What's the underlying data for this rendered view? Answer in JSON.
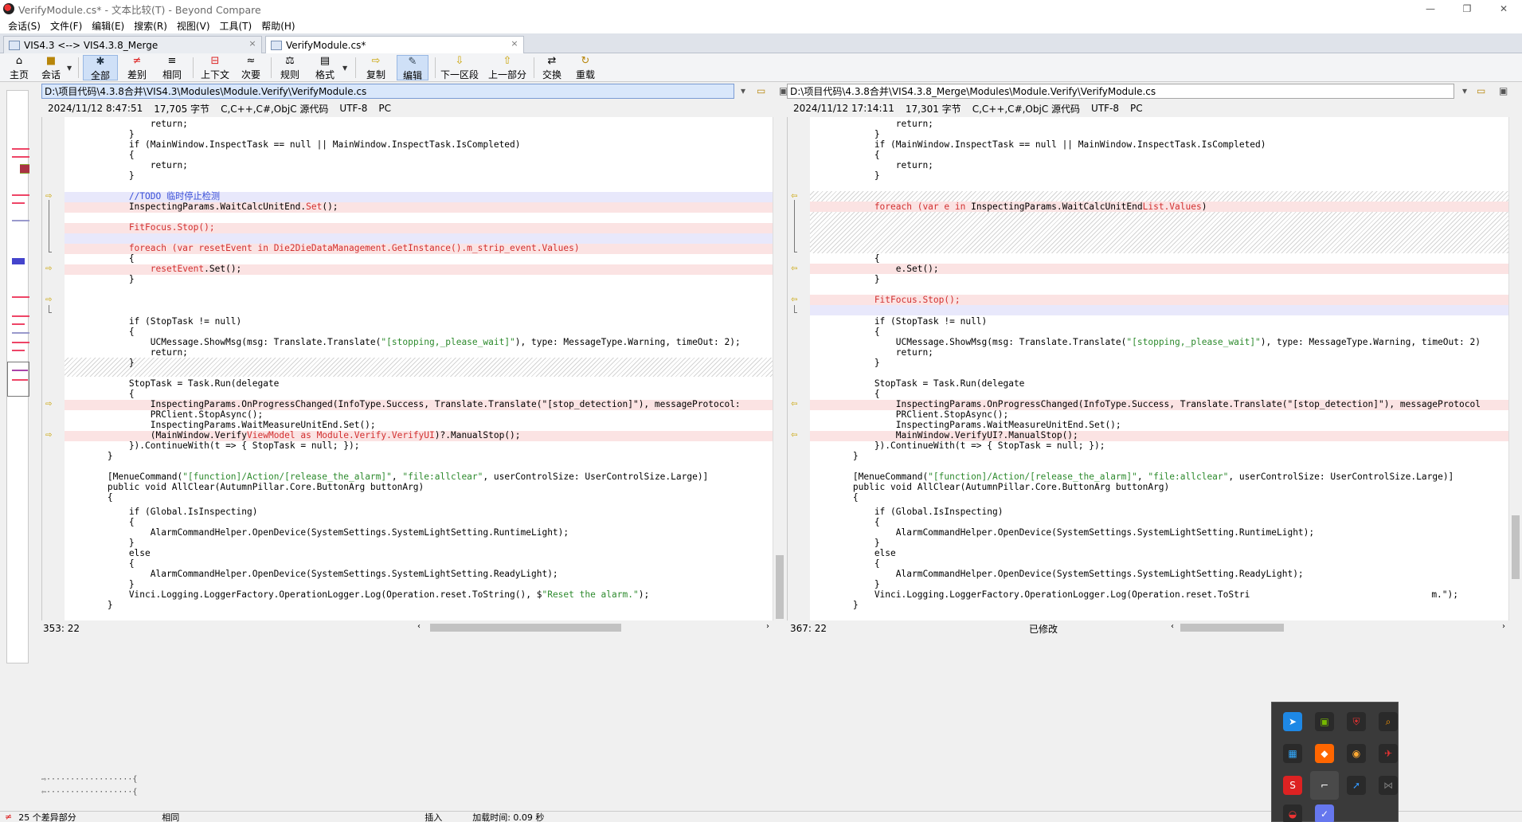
{
  "window": {
    "title": "VerifyModule.cs* - 文本比较(T) - Beyond Compare",
    "minimize": "—",
    "restore": "❐",
    "close": "✕"
  },
  "menu": [
    "会话(S)",
    "文件(F)",
    "编辑(E)",
    "搜索(R)",
    "视图(V)",
    "工具(T)",
    "帮助(H)"
  ],
  "tabs": [
    {
      "label": "VIS4.3 <--> VIS4.3.8_Merge",
      "close": "×"
    },
    {
      "label": "VerifyModule.cs*",
      "close": "×"
    }
  ],
  "toolbar": {
    "home": "主页",
    "session": "会话",
    "all": "全部",
    "diffs": "差别",
    "same": "相同",
    "context": "上下文",
    "minor": "次要",
    "rules": "规则",
    "format": "格式",
    "copy": "复制",
    "edit": "编辑",
    "next_section": "下一区段",
    "prev_section": "上一部分",
    "swap": "交换",
    "reload": "重载"
  },
  "left": {
    "path": "D:\\项目代码\\4.3.8合并\\VIS4.3\\Modules\\Module.Verify\\VerifyModule.cs",
    "timestamp": "2024/11/12 8:47:51",
    "size": "17,705 字节",
    "syntax": "C,C++,C#,ObjC 源代码",
    "encoding": "UTF-8",
    "lineend": "PC",
    "cursor": "353: 22",
    "modified": ""
  },
  "right": {
    "path": "D:\\项目代码\\4.3.8合并\\VIS4.3.8_Merge\\Modules\\Module.Verify\\VerifyModule.cs",
    "timestamp": "2024/11/12 17:14:11",
    "size": "17,301 字节",
    "syntax": "C,C++,C#,ObjC 源代码",
    "encoding": "UTF-8",
    "lineend": "PC",
    "cursor": "367: 22",
    "modified": "已修改"
  },
  "code_left": {
    "l1": "                return;",
    "l2": "            }",
    "l3": "            if (MainWindow.InspectTask == null || MainWindow.InspectTask.IsCompleted)",
    "l4": "            {",
    "l5": "                return;",
    "l6": "            }",
    "l7a": "            ",
    "l7b": "//TODO 临时停止检测",
    "l8a": "            InspectingParams.WaitCalcUnitEnd.",
    "l8b": "Set",
    "l8c": "();",
    "l9": "            FitFocus.Stop();",
    "l10a": "            foreach (var resetEvent in ",
    "l10b": "Die2DieDataManagement.GetInstance().m_strip_event.Values",
    "l10c": ")",
    "l11": "            {",
    "l12a": "                ",
    "l12b": "resetEvent",
    "l12c": ".Set();",
    "l13": "            }",
    "l14": "            if (StopTask != null)",
    "l15": "            {",
    "l16a": "                UCMessage.ShowMsg(msg: Translate.Translate(",
    "l16b": "\"[stopping,_please_wait]\"",
    "l16c": "), type: MessageType.Warning, timeOut: 2);",
    "l17": "                return;",
    "l18": "            }",
    "l19": "            StopTask = Task.Run(delegate",
    "l20": "            {",
    "l21": "                InspectingParams.OnProgressChanged(InfoType.Success, Translate.Translate(\"[stop_detection]\"), messageProtocol:",
    "l22": "                PRClient.StopAsync();",
    "l23": "                InspectingParams.WaitMeasureUnitEnd.Set();",
    "l24a": "                (MainWindow.Verify",
    "l24b": "ViewModel as Module.Verify.VerifyUI",
    "l24c": ")?.ManualStop();",
    "l25": "            }).ContinueWith(t => { StopTask = null; });",
    "l26": "        }",
    "l27a": "        [MenueCommand(",
    "l27b": "\"[function]/Action/[release_the_alarm]\"",
    "l27c": ", ",
    "l27d": "\"file:allclear\"",
    "l27e": ", userControlSize: UserControlSize.Large)]",
    "l28": "        public void AllClear(AutumnPillar.Core.ButtonArg buttonArg)",
    "l29": "        {",
    "l30": "            if (Global.IsInspecting)",
    "l31": "            {",
    "l32": "                AlarmCommandHelper.OpenDevice(SystemSettings.SystemLightSetting.RuntimeLight);",
    "l33": "            }",
    "l34": "            else",
    "l35": "            {",
    "l36": "                AlarmCommandHelper.OpenDevice(SystemSettings.SystemLightSetting.ReadyLight);",
    "l37": "            }",
    "l38a": "            Vinci.Logging.LoggerFactory.OperationLogger.Log(Operation.reset.ToString(), $",
    "l38b": "\"Reset the alarm.\"",
    "l38c": ");",
    "l39": "        }"
  },
  "code_right": {
    "r1": "                return;",
    "r2": "            }",
    "r3": "            if (MainWindow.InspectTask == null || MainWindow.InspectTask.IsCompleted)",
    "r4": "            {",
    "r5": "                return;",
    "r6": "            }",
    "r8a": "            foreach (var e in ",
    "r8b": "InspectingParams.WaitCalcUnitEnd",
    "r8c": "List.Values",
    "r8d": ")",
    "r11": "            {",
    "r12": "                e.Set();",
    "r13": "            }",
    "r13b": "            FitFocus.Stop();",
    "r14": "            if (StopTask != null)",
    "r15": "            {",
    "r16a": "                UCMessage.ShowMsg(msg: Translate.Translate(",
    "r16b": "\"[stopping,_please_wait]\"",
    "r16c": "), type: MessageType.Warning, timeOut: 2)",
    "r17": "                return;",
    "r18": "            }",
    "r19": "            StopTask = Task.Run(delegate",
    "r20": "            {",
    "r21": "                InspectingParams.OnProgressChanged(InfoType.Success, Translate.Translate(\"[stop_detection]\"), messageProtocol",
    "r22": "                PRClient.StopAsync();",
    "r23": "                InspectingParams.WaitMeasureUnitEnd.Set();",
    "r24": "                MainWindow.VerifyUI?.ManualStop();",
    "r25": "            }).ContinueWith(t => { StopTask = null; });",
    "r26": "        }",
    "r27a": "        [MenueCommand(",
    "r27b": "\"[function]/Action/[release_the_alarm]\"",
    "r27c": ", ",
    "r27d": "\"file:allclear\"",
    "r27e": ", userControlSize: UserControlSize.Large)]",
    "r28": "        public void AllClear(AutumnPillar.Core.ButtonArg buttonArg)",
    "r29": "        {",
    "r30": "            if (Global.IsInspecting)",
    "r31": "            {",
    "r32": "                AlarmCommandHelper.OpenDevice(SystemSettings.SystemLightSetting.RuntimeLight);",
    "r33": "            }",
    "r34": "            else",
    "r35": "            {",
    "r36": "                AlarmCommandHelper.OpenDevice(SystemSettings.SystemLightSetting.ReadyLight);",
    "r37": "            }",
    "r38a": "            Vinci.Logging.LoggerFactory.OperationLogger.Log(Operation.reset.ToStri",
    "r38b": "m.\");",
    "r39": "        }"
  },
  "lineview": {
    "top": "⇨··················{",
    "bottom": "⇦··················{"
  },
  "status": {
    "diff_count": "25 个差异部分",
    "same": "相同",
    "insert": "插入",
    "load_time": "加载时间: 0.09 秒"
  },
  "colors": {
    "diff_bg": "#fbe3e3",
    "diff_text": "#d23030",
    "accent": "#98b7e3"
  }
}
